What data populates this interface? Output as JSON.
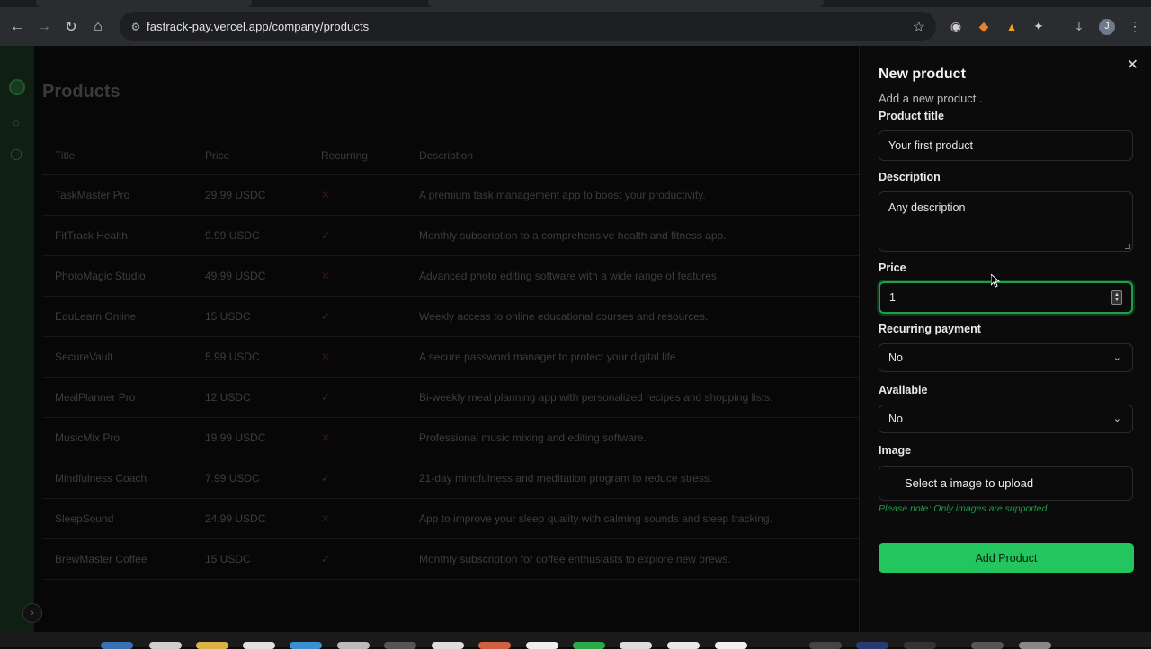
{
  "browser": {
    "url": "fastrack-pay.vercel.app/company/products",
    "profile_initial": "J"
  },
  "products_page": {
    "title": "Products",
    "columns": [
      "Title",
      "Price",
      "Recurring",
      "Description"
    ],
    "rows": [
      {
        "title": "TaskMaster Pro",
        "price": "29.99 USDC",
        "recurring": "✕",
        "description": "A premium task management app to boost your productivity."
      },
      {
        "title": "FitTrack Health",
        "price": "9.99 USDC",
        "recurring": "✓",
        "description": "Monthly subscription to a comprehensive health and fitness app."
      },
      {
        "title": "PhotoMagic Studio",
        "price": "49.99 USDC",
        "recurring": "✕",
        "description": "Advanced photo editing software with a wide range of features."
      },
      {
        "title": "EduLearn Online",
        "price": "15 USDC",
        "recurring": "✓",
        "description": "Weekly access to online educational courses and resources."
      },
      {
        "title": "SecureVault",
        "price": "5.99 USDC",
        "recurring": "✕",
        "description": "A secure password manager to protect your digital life."
      },
      {
        "title": "MealPlanner Pro",
        "price": "12 USDC",
        "recurring": "✓",
        "description": "Bi-weekly meal planning app with personalized recipes and shopping lists."
      },
      {
        "title": "MusicMix Pro",
        "price": "19.99 USDC",
        "recurring": "✕",
        "description": "Professional music mixing and editing software."
      },
      {
        "title": "Mindfulness Coach",
        "price": "7.99 USDC",
        "recurring": "✓",
        "description": "21-day mindfulness and meditation program to reduce stress."
      },
      {
        "title": "SleepSound",
        "price": "24.99 USDC",
        "recurring": "✕",
        "description": "App to improve your sleep quality with calming sounds and sleep tracking."
      },
      {
        "title": "BrewMaster Coffee",
        "price": "15 USDC",
        "recurring": "✓",
        "description": "Monthly subscription for coffee enthusiasts to explore new brews."
      }
    ]
  },
  "new_product": {
    "title": "New product",
    "subtitle": "Add a new product .",
    "product_title_label": "Product title",
    "product_title_value": "Your first product",
    "description_label": "Description",
    "description_value": "Any description",
    "price_label": "Price",
    "price_value": "1",
    "recurring_label": "Recurring payment",
    "recurring_value": "No",
    "available_label": "Available",
    "available_value": "No",
    "image_label": "Image",
    "upload_label": "Select a image to upload",
    "note": "Please note: Only images are supported.",
    "submit_label": "Add Product"
  },
  "colors": {
    "accent": "#22c55e",
    "focus": "#1f9d4a",
    "panel_bg": "#0b0b0b"
  }
}
